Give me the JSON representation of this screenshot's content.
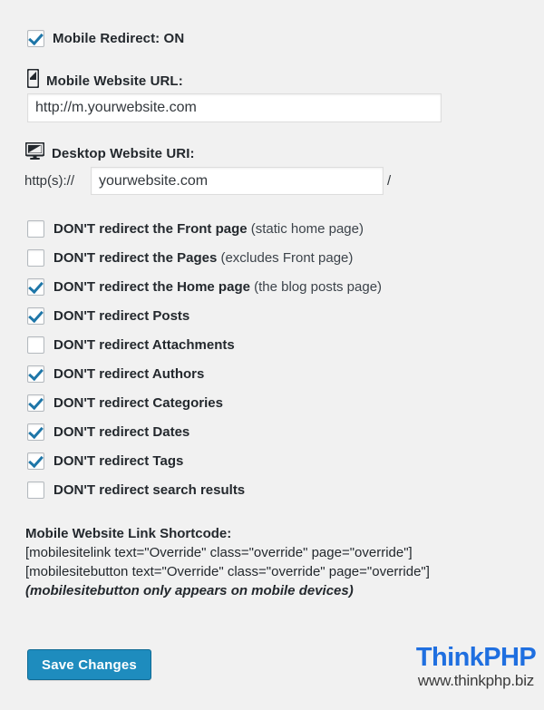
{
  "colors": {
    "background": "#f1f1f1",
    "accent": "#1e8cbe",
    "check": "#1e76a8",
    "brand_blue": "#1f6fe0"
  },
  "redirect_toggle": {
    "label": "Mobile Redirect: ON",
    "checked": true
  },
  "mobile_url": {
    "icon": "mobile-phone-icon",
    "label": "Mobile Website URL:",
    "value": "http://m.yourwebsite.com",
    "placeholder": "http://m.yourwebsite.com"
  },
  "desktop_uri": {
    "icon": "desktop-monitor-icon",
    "label": "Desktop Website URI:",
    "prefix": "http(s)://",
    "value": "yourwebsite.com",
    "placeholder": "yourwebsite.com",
    "suffix": "/"
  },
  "options": [
    {
      "main": "DON'T redirect the Front page",
      "note": " (static home page)",
      "checked": false
    },
    {
      "main": "DON'T redirect the Pages",
      "note": " (excludes Front page)",
      "checked": false
    },
    {
      "main": "DON'T redirect the Home page",
      "note": " (the blog posts page)",
      "checked": true
    },
    {
      "main": "DON'T redirect Posts",
      "note": "",
      "checked": true
    },
    {
      "main": "DON'T redirect Attachments",
      "note": "",
      "checked": false
    },
    {
      "main": "DON'T redirect Authors",
      "note": "",
      "checked": true
    },
    {
      "main": "DON'T redirect Categories",
      "note": "",
      "checked": true
    },
    {
      "main": "DON'T redirect Dates",
      "note": "",
      "checked": true
    },
    {
      "main": "DON'T redirect Tags",
      "note": "",
      "checked": true
    },
    {
      "main": "DON'T redirect search results",
      "note": "",
      "checked": false
    }
  ],
  "shortcode": {
    "title": "Mobile Website Link Shortcode:",
    "line1": "[mobilesitelink text=\"Override\" class=\"override\" page=\"override\"]",
    "line2": "[mobilesitebutton text=\"Override\" class=\"override\" page=\"override\"]",
    "note": "(mobilesitebutton only appears on mobile devices)"
  },
  "save_button": {
    "label": "Save Changes"
  },
  "watermark": {
    "brand": "ThinkPHP",
    "url": "www.thinkphp.biz"
  }
}
